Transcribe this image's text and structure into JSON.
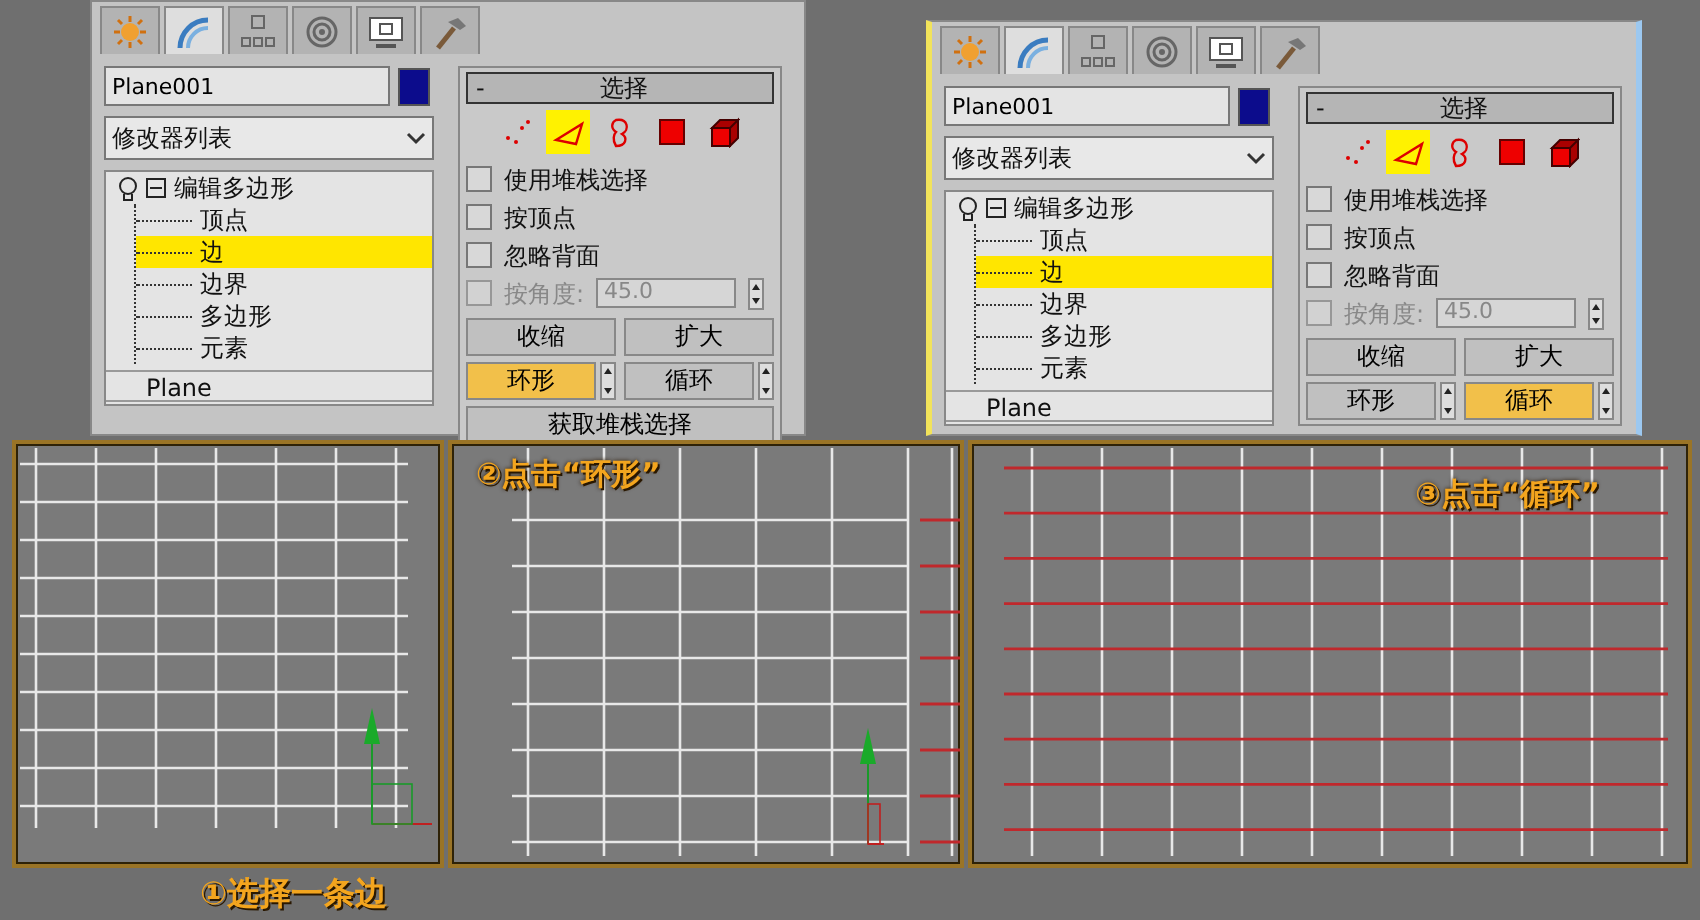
{
  "panels": [
    {
      "tabs": [
        {
          "selected": false
        },
        {
          "selected": true
        },
        {
          "selected": false
        },
        {
          "selected": false
        },
        {
          "selected": false
        },
        {
          "selected": false
        }
      ],
      "object_name": "Plane001",
      "color": "#0c0c8c",
      "modifier_list": "修改器列表",
      "stack": [
        {
          "label": "编辑多边形",
          "expanded": true,
          "selected": false,
          "children": [
            {
              "label": "顶点",
              "selected": false
            },
            {
              "label": "边",
              "selected": true
            },
            {
              "label": "边界",
              "selected": false
            },
            {
              "label": "多边形",
              "selected": false
            },
            {
              "label": "元素",
              "selected": false
            }
          ]
        },
        {
          "label": "Plane",
          "selected": false
        }
      ],
      "rollout": {
        "title": "选择",
        "toggle": "-",
        "subobjects": [
          {
            "selected": false
          },
          {
            "selected": true
          },
          {
            "selected": false
          },
          {
            "selected": false
          },
          {
            "selected": false
          }
        ],
        "options": [
          {
            "label": "使用堆栈选择",
            "checked": false,
            "disabled": false
          },
          {
            "label": "按顶点",
            "checked": false,
            "disabled": false
          },
          {
            "label": "忽略背面",
            "checked": false,
            "disabled": false
          },
          {
            "label": "按角度:",
            "checked": false,
            "disabled": true,
            "value": "45.0"
          }
        ],
        "buttons": [
          {
            "label": "收缩",
            "active": false,
            "spinner": false
          },
          {
            "label": "扩大",
            "active": false,
            "spinner": false
          },
          {
            "label": "环形",
            "active": true,
            "spinner": true
          },
          {
            "label": "循环",
            "active": false,
            "spinner": true
          },
          {
            "label": "获取堆栈选择",
            "active": false,
            "spinner": false
          }
        ]
      }
    },
    {
      "tabs": [
        {
          "selected": false
        },
        {
          "selected": true
        },
        {
          "selected": false
        },
        {
          "selected": false
        },
        {
          "selected": false
        },
        {
          "selected": false
        }
      ],
      "object_name": "Plane001",
      "color": "#0c0c8c",
      "modifier_list": "修改器列表",
      "stack": [
        {
          "label": "编辑多边形",
          "expanded": true,
          "selected": false,
          "children": [
            {
              "label": "顶点",
              "selected": false
            },
            {
              "label": "边",
              "selected": true
            },
            {
              "label": "边界",
              "selected": false
            },
            {
              "label": "多边形",
              "selected": false
            },
            {
              "label": "元素",
              "selected": false
            }
          ]
        },
        {
          "label": "Plane",
          "selected": false
        }
      ],
      "rollout": {
        "title": "选择",
        "toggle": "-",
        "subobjects": [
          {
            "selected": false
          },
          {
            "selected": true
          },
          {
            "selected": false
          },
          {
            "selected": false
          },
          {
            "selected": false
          }
        ],
        "options": [
          {
            "label": "使用堆栈选择",
            "checked": false,
            "disabled": false
          },
          {
            "label": "按顶点",
            "checked": false,
            "disabled": false
          },
          {
            "label": "忽略背面",
            "checked": false,
            "disabled": false
          },
          {
            "label": "按角度:",
            "checked": false,
            "disabled": true,
            "value": "45.0"
          }
        ],
        "buttons": [
          {
            "label": "收缩",
            "active": false,
            "spinner": false
          },
          {
            "label": "扩大",
            "active": false,
            "spinner": false
          },
          {
            "label": "环形",
            "active": false,
            "spinner": true
          },
          {
            "label": "循环",
            "active": true,
            "spinner": true
          }
        ]
      }
    }
  ],
  "viewports": [
    {
      "kind": "plain",
      "gizmo": true
    },
    {
      "kind": "ring",
      "gizmo": true,
      "label": "②点击“环形”"
    },
    {
      "kind": "loop",
      "gizmo": false,
      "label": "③点击“循环”"
    }
  ],
  "caption": "①选择一条边"
}
